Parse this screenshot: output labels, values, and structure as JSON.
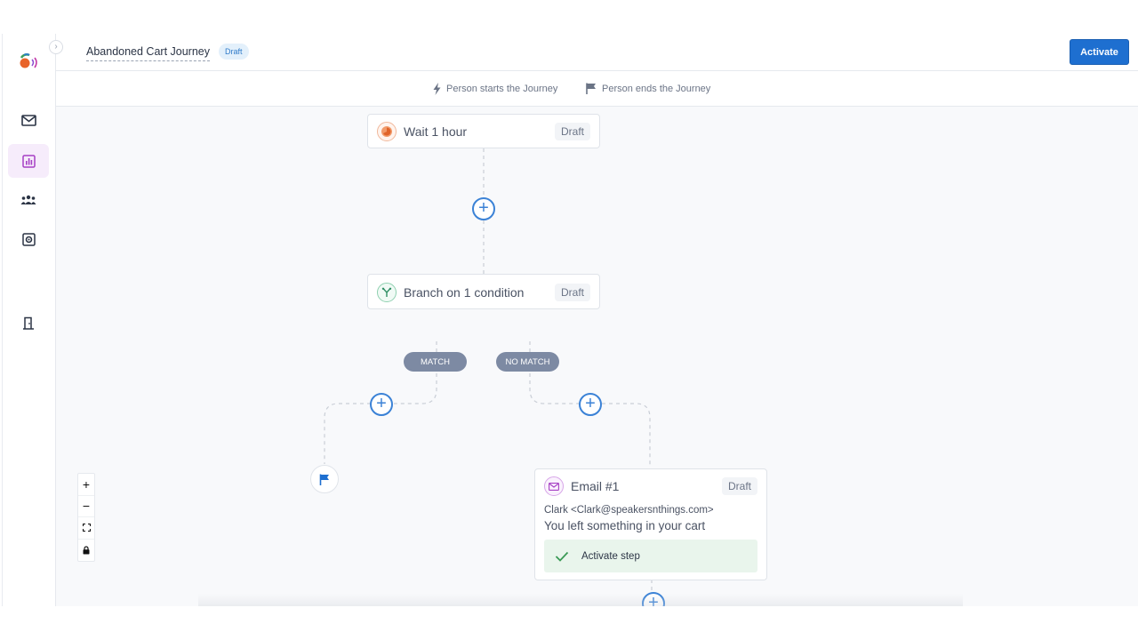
{
  "header": {
    "journey_title": "Abandoned Cart Journey",
    "status_badge": "Draft",
    "activate_label": "Activate"
  },
  "legend": {
    "start_label": "Person starts the Journey",
    "end_label": "Person ends the Journey"
  },
  "sidebar": {
    "items": [
      {
        "icon": "mail-icon",
        "active": false
      },
      {
        "icon": "chart-icon",
        "active": true
      },
      {
        "icon": "people-icon",
        "active": false
      },
      {
        "icon": "settings-icon",
        "active": false
      },
      {
        "icon": "door-icon",
        "active": false
      }
    ]
  },
  "nodes": {
    "wait": {
      "title": "Wait 1 hour",
      "status": "Draft"
    },
    "branch": {
      "title": "Branch on 1 condition",
      "status": "Draft",
      "match_label": "MATCH",
      "no_match_label": "NO MATCH"
    },
    "email": {
      "title": "Email #1",
      "status": "Draft",
      "from": "Clark <Clark@speakersnthings.com>",
      "subject": "You left something in your cart",
      "activate_step_label": "Activate step"
    }
  },
  "zoom_controls": [
    "+",
    "−",
    "fit",
    "lock"
  ],
  "colors": {
    "accent": "#1e6fd0",
    "add_button": "#3b82d6",
    "branch_pill": "#7d8aa3",
    "active_nav": "#f6ecfb",
    "success_bg": "#e9f5ec"
  }
}
